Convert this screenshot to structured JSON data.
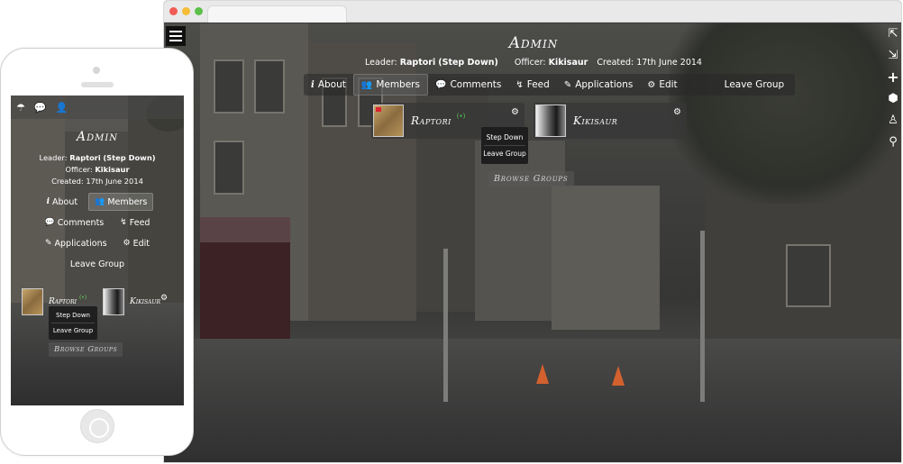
{
  "group": {
    "title": "Admin",
    "leader_label": "Leader:",
    "leader_name": "Raptori",
    "leader_action": "(Step Down)",
    "officer_label": "Officer:",
    "officer_name": "Kikisaur",
    "created_text": "Created: 17th June 2014"
  },
  "nav": {
    "about": "About",
    "members": "Members",
    "comments": "Comments",
    "feed": "Feed",
    "applications": "Applications",
    "edit": "Edit",
    "leave": "Leave Group"
  },
  "members": [
    {
      "name": "Raptori",
      "status": "(•)"
    },
    {
      "name": "Kikisaur"
    }
  ],
  "member_menu": {
    "step_down": "Step Down",
    "leave_group": "Leave Group"
  },
  "browse_label": "Browse Groups",
  "icons": {
    "hamburger": "menu-icon",
    "right_sidebar": [
      "exit-icon",
      "exit-alt-icon",
      "plus-icon",
      "shield-icon",
      "person-icon",
      "location-pin-icon"
    ],
    "about": "info-icon",
    "members": "people-icon",
    "comments": "comment-bubbles-icon",
    "feed": "rss-feed-icon",
    "applications": "edit-form-icon",
    "edit": "gear-icon",
    "phone_topbar": [
      "mushroom-icon",
      "chat-bubble-icon",
      "user-icon"
    ]
  },
  "colors": {
    "online": "#5bd15b",
    "dropdown_bg": "#1e1e1e",
    "nav_bar_bg": "#282828"
  }
}
